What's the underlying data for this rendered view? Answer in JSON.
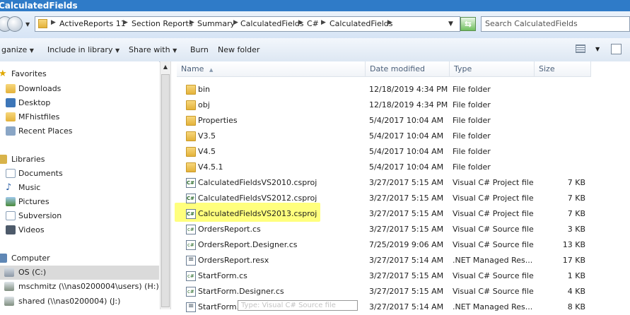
{
  "window": {
    "title": "CalculatedFields"
  },
  "address": {
    "crumbs": [
      "ActiveReports 11",
      "Section Reports",
      "Summary",
      "CalculatedFields",
      "C#",
      "CalculatedFields"
    ],
    "search_placeholder": "Search CalculatedFields"
  },
  "toolbar": {
    "organize": "ganize",
    "include_in_library": "Include in library",
    "share_with": "Share with",
    "burn": "Burn",
    "new_folder": "New folder"
  },
  "nav": {
    "favorites": "Favorites",
    "favorites_items": [
      "Downloads",
      "Desktop",
      "MFhistfiles",
      "Recent Places"
    ],
    "libraries": "Libraries",
    "libraries_items": [
      "Documents",
      "Music",
      "Pictures",
      "Subversion",
      "Videos"
    ],
    "computer": "Computer",
    "drives": [
      "OS (C:)",
      "mschmitz (\\\\nas0200004\\users) (H:)",
      "shared (\\\\nas0200004) (J:)"
    ]
  },
  "columns": {
    "name": "Name",
    "date": "Date modified",
    "type": "Type",
    "size": "Size"
  },
  "files": [
    {
      "name": "bin",
      "date": "12/18/2019 4:34 PM",
      "type": "File folder",
      "size": "",
      "icon": "folder"
    },
    {
      "name": "obj",
      "date": "12/18/2019 4:34 PM",
      "type": "File folder",
      "size": "",
      "icon": "folder"
    },
    {
      "name": "Properties",
      "date": "5/4/2017 10:04 AM",
      "type": "File folder",
      "size": "",
      "icon": "folder"
    },
    {
      "name": "V3.5",
      "date": "5/4/2017 10:04 AM",
      "type": "File folder",
      "size": "",
      "icon": "folder"
    },
    {
      "name": "V4.5",
      "date": "5/4/2017 10:04 AM",
      "type": "File folder",
      "size": "",
      "icon": "folder"
    },
    {
      "name": "V4.5.1",
      "date": "5/4/2017 10:04 AM",
      "type": "File folder",
      "size": "",
      "icon": "folder"
    },
    {
      "name": "CalculatedFieldsVS2010.csproj",
      "date": "3/27/2017 5:15 AM",
      "type": "Visual C# Project file",
      "size": "7 KB",
      "icon": "proj"
    },
    {
      "name": "CalculatedFieldsVS2012.csproj",
      "date": "3/27/2017 5:15 AM",
      "type": "Visual C# Project file",
      "size": "7 KB",
      "icon": "proj"
    },
    {
      "name": "CalculatedFieldsVS2013.csproj",
      "date": "3/27/2017 5:15 AM",
      "type": "Visual C# Project file",
      "size": "7 KB",
      "icon": "proj"
    },
    {
      "name": "OrdersReport.cs",
      "date": "3/27/2017 5:15 AM",
      "type": "Visual C# Source file",
      "size": "3 KB",
      "icon": "cs"
    },
    {
      "name": "OrdersReport.Designer.cs",
      "date": "7/25/2019 9:06 AM",
      "type": "Visual C# Source file",
      "size": "13 KB",
      "icon": "cs"
    },
    {
      "name": "OrdersReport.resx",
      "date": "3/27/2017 5:14 AM",
      "type": ".NET Managed Res...",
      "size": "17 KB",
      "icon": "resx"
    },
    {
      "name": "StartForm.cs",
      "date": "3/27/2017 5:15 AM",
      "type": "Visual C# Source file",
      "size": "1 KB",
      "icon": "cs"
    },
    {
      "name": "StartForm.Designer.cs",
      "date": "3/27/2017 5:15 AM",
      "type": "Visual C# Source file",
      "size": "4 KB",
      "icon": "cs"
    },
    {
      "name": "StartForm.resx",
      "date": "3/27/2017 5:14 AM",
      "type": ".NET Managed Res...",
      "size": "8 KB",
      "icon": "resx"
    }
  ],
  "tooltip": "Type: Visual C# Source file",
  "colors": {
    "titlebar": "#2f7bc8",
    "highlight": "#ffff66",
    "selection": "#dadada"
  }
}
